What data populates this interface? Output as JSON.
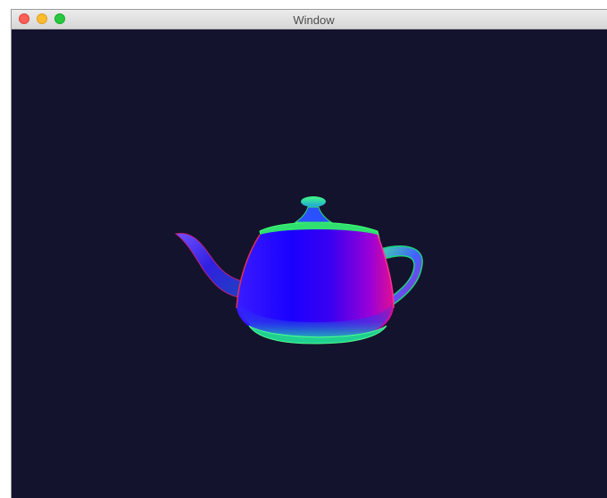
{
  "window": {
    "title": "Window"
  },
  "titlebar_buttons": [
    {
      "name": "close",
      "color": "#fe5f57"
    },
    {
      "name": "minimize",
      "color": "#febc2e"
    },
    {
      "name": "maximize",
      "color": "#28c840"
    }
  ],
  "viewport": {
    "background_color": "#14132e",
    "content": "normal-shaded-teapot"
  }
}
